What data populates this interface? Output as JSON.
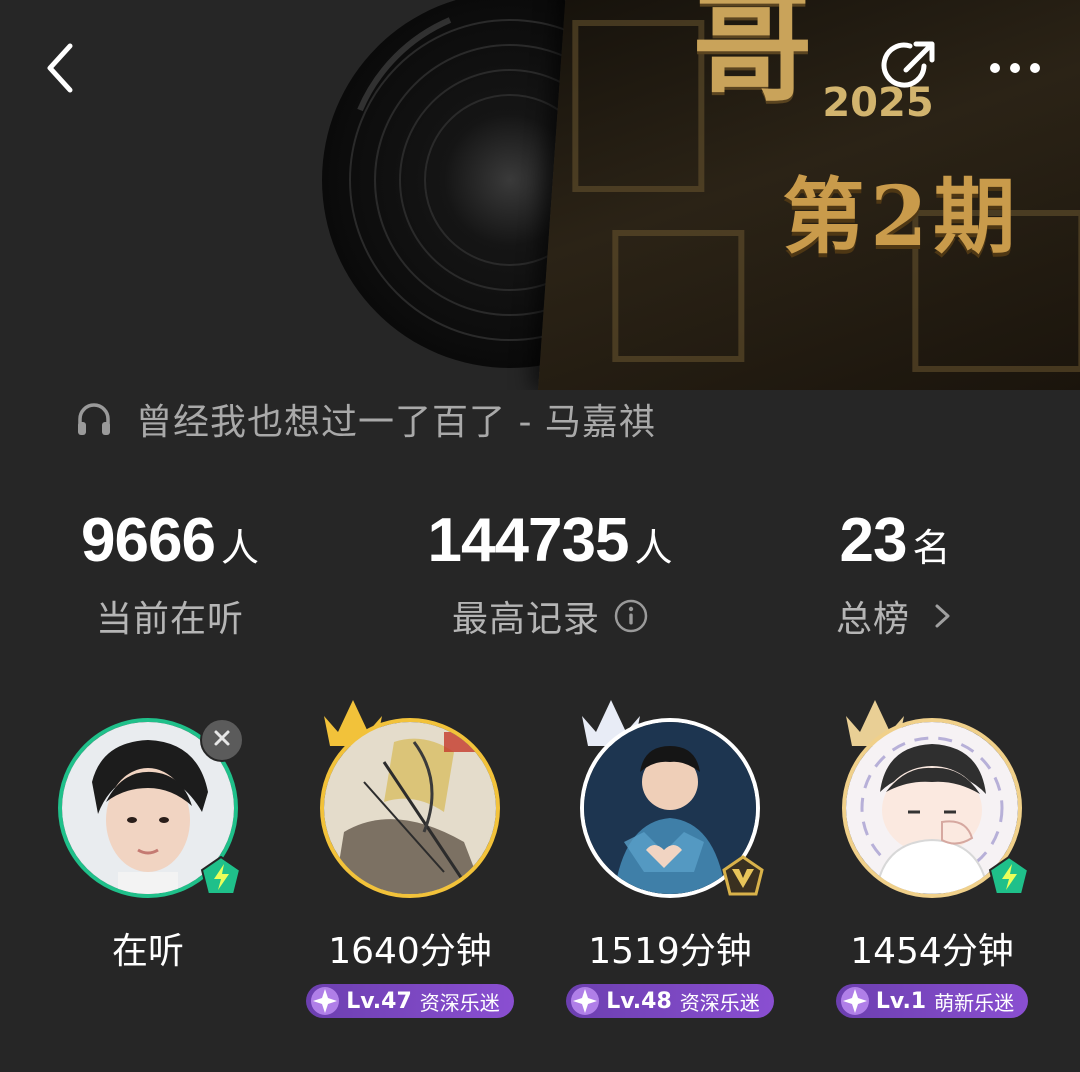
{
  "header": {
    "back_icon": "chevron-left-icon",
    "share_icon": "share-icon",
    "more_icon": "more-dots-icon"
  },
  "cover": {
    "brand_text": "哥",
    "year": "2025",
    "episode": "第2期"
  },
  "song": {
    "icon": "headphones-icon",
    "text": "曾经我也想过一了百了 - 马嘉祺"
  },
  "stats": [
    {
      "value": "9666",
      "unit": "人",
      "label": "当前在听"
    },
    {
      "value": "144735",
      "unit": "人",
      "label": "最高记录"
    },
    {
      "value": "23",
      "unit": "名",
      "label": "总榜"
    }
  ],
  "listeners": [
    {
      "label": "在听",
      "level": null,
      "level_title": null,
      "border_color": "#1fc08a"
    },
    {
      "label": "1640分钟",
      "level": "Lv.47",
      "level_title": "资深乐迷",
      "border_color": "#f2c23a"
    },
    {
      "label": "1519分钟",
      "level": "Lv.48",
      "level_title": "资深乐迷",
      "border_color": "#ffffff"
    },
    {
      "label": "1454分钟",
      "level": "Lv.1",
      "level_title": "萌新乐迷",
      "border_color": "#f0d08a"
    }
  ],
  "colors": {
    "background": "#262626",
    "accent_green": "#1fc08a",
    "level_purple": "#7b45c4",
    "gold": "#c9a35a"
  }
}
